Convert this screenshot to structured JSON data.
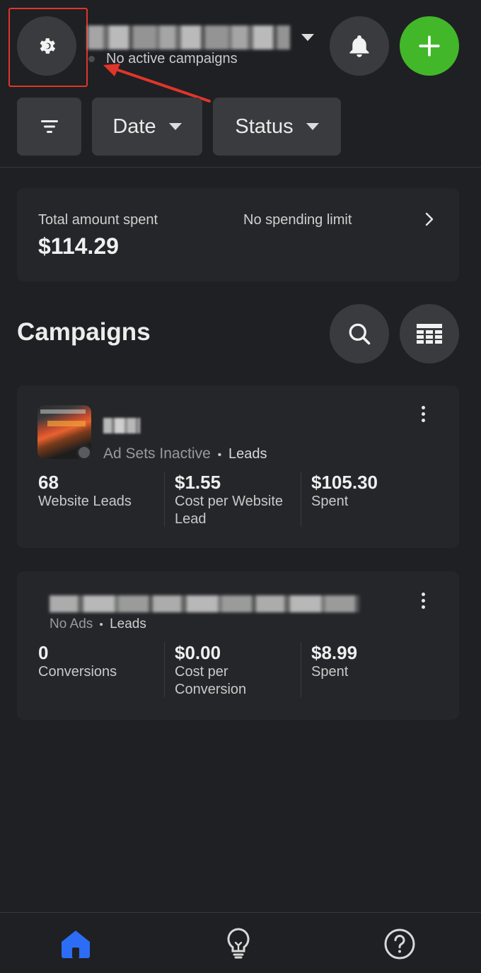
{
  "header": {
    "account_subtitle": "No active campaigns",
    "icons": {
      "settings": "gear-icon",
      "notifications": "bell-icon",
      "create": "plus-icon"
    },
    "colors": {
      "create_button": "#42b72a",
      "annotation": "#e0352b"
    }
  },
  "filters": {
    "filter_icon": "filter-icon",
    "date_label": "Date",
    "status_label": "Status"
  },
  "spend_summary": {
    "label": "Total amount spent",
    "amount": "$114.29",
    "limit_text": "No spending limit"
  },
  "campaigns": {
    "title": "Campaigns",
    "icons": {
      "search": "search-icon",
      "table": "table-icon"
    },
    "items": [
      {
        "status": "Ad Sets Inactive",
        "objective": "Leads",
        "metrics": [
          {
            "value": "68",
            "label": "Website Leads"
          },
          {
            "value": "$1.55",
            "label": "Cost per Website Lead"
          },
          {
            "value": "$105.30",
            "label": "Spent"
          }
        ]
      },
      {
        "status": "No Ads",
        "objective": "Leads",
        "metrics": [
          {
            "value": "0",
            "label": "Conversions"
          },
          {
            "value": "$0.00",
            "label": "Cost per Conversion"
          },
          {
            "value": "$8.99",
            "label": "Spent"
          }
        ]
      }
    ]
  },
  "bottom_nav": {
    "items": [
      "home-icon",
      "lightbulb-icon",
      "help-icon"
    ],
    "active_color": "#2d6df6"
  }
}
